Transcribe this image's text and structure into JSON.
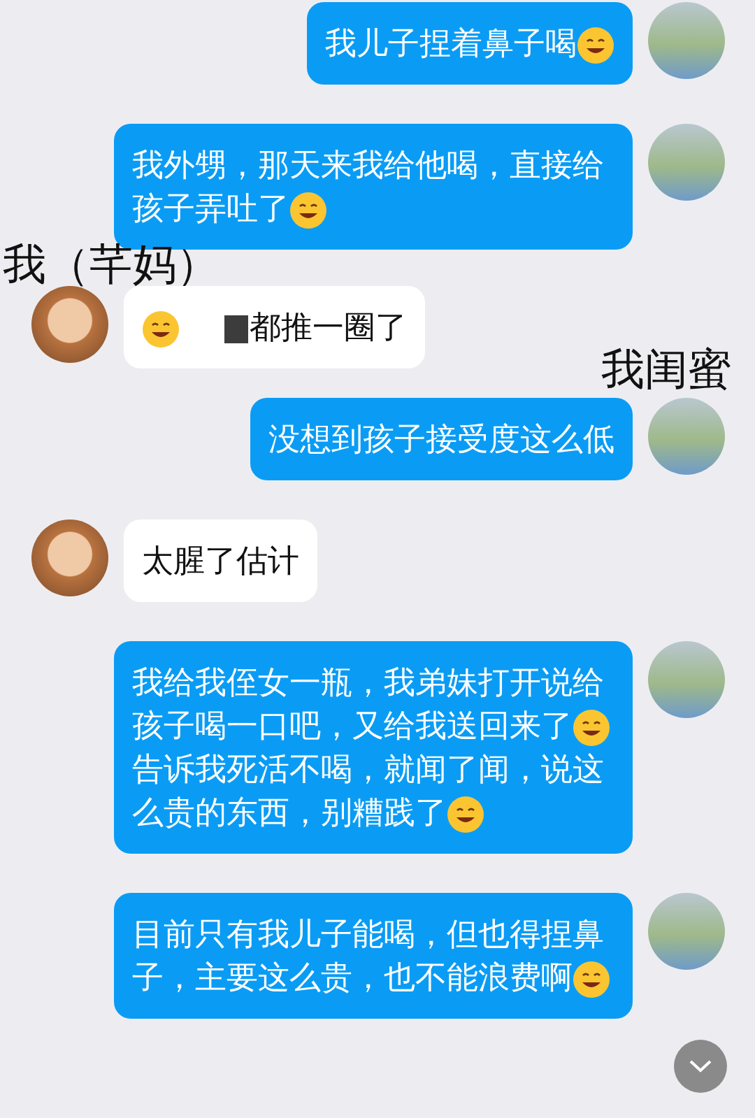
{
  "messages": [
    {
      "kind": "outgoing",
      "segments": [
        {
          "kind": "text",
          "text": "我儿子捏着鼻子喝"
        },
        {
          "kind": "emoji"
        }
      ]
    },
    {
      "kind": "outgoing",
      "segments": [
        {
          "kind": "text",
          "text": "我外甥，那天来我给他喝，直接给孩子弄吐了"
        },
        {
          "kind": "emoji"
        }
      ]
    },
    {
      "kind": "label",
      "text": "我（芊妈）"
    },
    {
      "kind": "incoming",
      "segments": [
        {
          "kind": "emoji"
        },
        {
          "kind": "redacted"
        },
        {
          "kind": "text",
          "text": "都推一圈了"
        }
      ]
    },
    {
      "kind": "label_right",
      "text": "我闺蜜"
    },
    {
      "kind": "outgoing",
      "segments": [
        {
          "kind": "text",
          "text": "没想到孩子接受度这么低"
        }
      ]
    },
    {
      "kind": "incoming",
      "segments": [
        {
          "kind": "text",
          "text": "太腥了估计"
        }
      ]
    },
    {
      "kind": "outgoing",
      "segments": [
        {
          "kind": "text",
          "text": "我给我侄女一瓶，我弟妹打开说给孩子喝一口吧，又给我送回来了"
        },
        {
          "kind": "emoji"
        },
        {
          "kind": "text",
          "text": "告诉我死活不喝，就闻了闻，说这么贵的东西，别糟践了"
        },
        {
          "kind": "emoji"
        }
      ]
    },
    {
      "kind": "outgoing",
      "segments": [
        {
          "kind": "text",
          "text": "目前只有我儿子能喝，但也得捏鼻子，主要这么贵，也不能浪费啊"
        },
        {
          "kind": "emoji"
        }
      ]
    }
  ]
}
